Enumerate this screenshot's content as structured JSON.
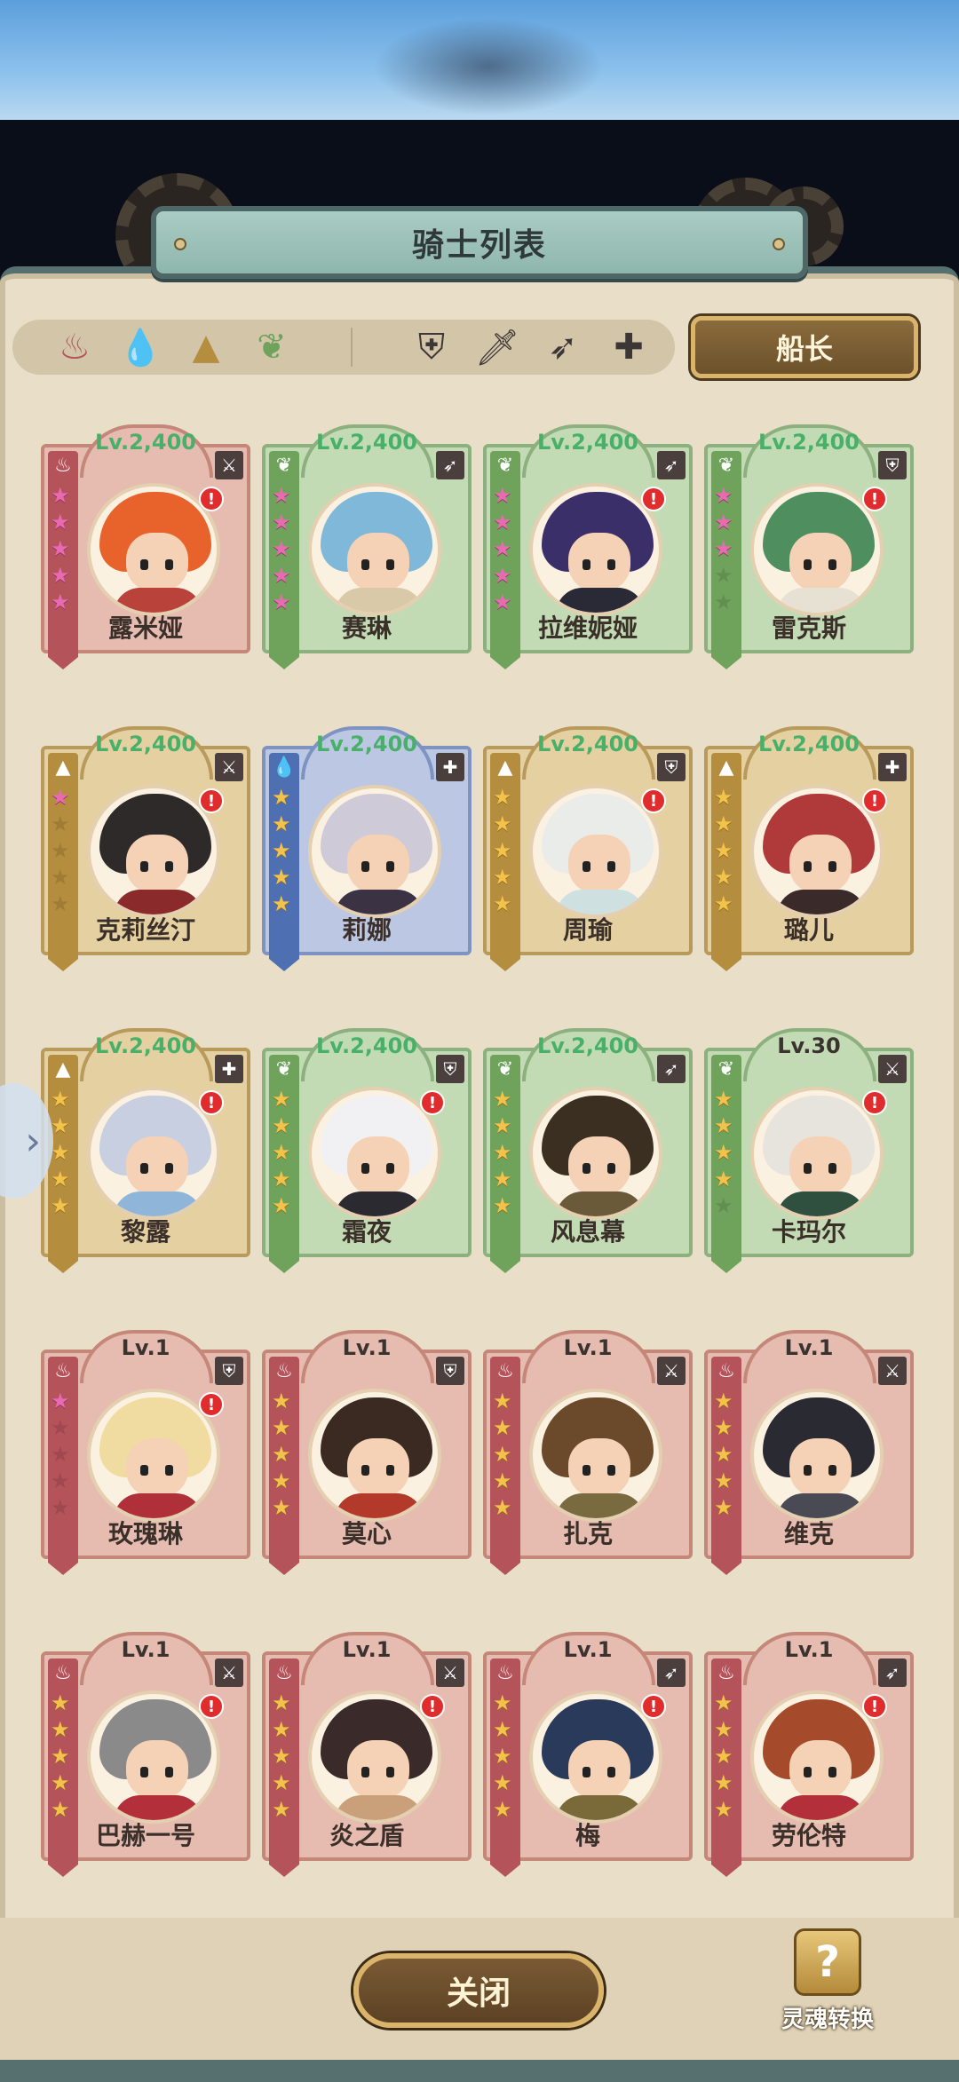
{
  "title": "骑士列表",
  "captain_label": "船长",
  "close_label": "关闭",
  "soul_convert_label": "灵魂转换",
  "soul_icon_glyph": "?",
  "side_arrow_glyph": "›",
  "filters": {
    "elements": [
      {
        "name": "fire-filter",
        "glyph": "♨",
        "color": "#b5535a"
      },
      {
        "name": "water-filter",
        "glyph": "💧",
        "color": "#4f6fb3"
      },
      {
        "name": "earth-filter",
        "glyph": "▲",
        "color": "#b58d3e"
      },
      {
        "name": "wind-filter",
        "glyph": "❦",
        "color": "#6fa35c"
      }
    ],
    "classes": [
      {
        "name": "shield-filter",
        "glyph": "⛨"
      },
      {
        "name": "sword-filter",
        "glyph": "🗡"
      },
      {
        "name": "bow-filter",
        "glyph": "➶"
      },
      {
        "name": "support-filter",
        "glyph": "✚"
      }
    ]
  },
  "knights": [
    {
      "name": "露米娅",
      "level": "Lv.2,400",
      "element": "fire",
      "stars": 5,
      "star_color": "pink",
      "class_glyph": "⚔",
      "alert": true,
      "hair": "#e8622c",
      "body": "#b9423a"
    },
    {
      "name": "赛琳",
      "level": "Lv.2,400",
      "element": "wind",
      "stars": 5,
      "star_color": "pink",
      "class_glyph": "➶",
      "alert": false,
      "hair": "#7fb8d8",
      "body": "#d9c9a8"
    },
    {
      "name": "拉维妮娅",
      "level": "Lv.2,400",
      "element": "wind",
      "stars": 5,
      "star_color": "pink",
      "class_glyph": "➶",
      "alert": true,
      "hair": "#3b2f6a",
      "body": "#2a2a36"
    },
    {
      "name": "雷克斯",
      "level": "Lv.2,400",
      "element": "wind",
      "stars": 3,
      "star_color": "pink",
      "class_glyph": "⛨",
      "alert": true,
      "hair": "#4f8f5f",
      "body": "#e7e1d4"
    },
    {
      "name": "克莉丝汀",
      "level": "Lv.2,400",
      "element": "earth",
      "stars": 1,
      "star_color": "pink",
      "class_glyph": "⚔",
      "alert": true,
      "hair": "#2e2a2a",
      "body": "#8a2a2a"
    },
    {
      "name": "莉娜",
      "level": "Lv.2,400",
      "element": "water",
      "stars": 5,
      "star_color": "gold",
      "class_glyph": "✚",
      "alert": false,
      "hair": "#cfcad8",
      "body": "#3b3344"
    },
    {
      "name": "周瑜",
      "level": "Lv.2,400",
      "element": "earth",
      "stars": 5,
      "star_color": "gold",
      "class_glyph": "⛨",
      "alert": true,
      "hair": "#e9ece8",
      "body": "#cfe0e0"
    },
    {
      "name": "璐儿",
      "level": "Lv.2,400",
      "element": "earth",
      "stars": 5,
      "star_color": "gold",
      "class_glyph": "✚",
      "alert": true,
      "hair": "#b03a3a",
      "body": "#3a2a2a"
    },
    {
      "name": "黎露",
      "level": "Lv.2,400",
      "element": "earth",
      "stars": 5,
      "star_color": "gold",
      "class_glyph": "✚",
      "alert": true,
      "hair": "#c7cfe0",
      "body": "#8fb6d8"
    },
    {
      "name": "霜夜",
      "level": "Lv.2,400",
      "element": "wind",
      "stars": 5,
      "star_color": "gold",
      "class_glyph": "⛨",
      "alert": true,
      "hair": "#f1f1f4",
      "body": "#2a2a30"
    },
    {
      "name": "风息幕",
      "level": "Lv.2,400",
      "element": "wind",
      "stars": 5,
      "star_color": "gold",
      "class_glyph": "➶",
      "alert": false,
      "hair": "#3a2f20",
      "body": "#6a5a3a"
    },
    {
      "name": "卡玛尔",
      "level": "Lv.30",
      "element": "wind",
      "stars": 4,
      "star_color": "gold",
      "class_glyph": "⚔",
      "alert": true,
      "hair": "#e6e4dc",
      "body": "#2f4f3f"
    },
    {
      "name": "玫瑰琳",
      "level": "Lv.1",
      "element": "fire",
      "stars": 1,
      "star_color": "pink",
      "class_glyph": "⛨",
      "alert": true,
      "hair": "#f0dca0",
      "body": "#b0303a"
    },
    {
      "name": "莫心",
      "level": "Lv.1",
      "element": "fire",
      "stars": 5,
      "star_color": "gold",
      "class_glyph": "⛨",
      "alert": false,
      "hair": "#3a2a22",
      "body": "#b33a2a"
    },
    {
      "name": "扎克",
      "level": "Lv.1",
      "element": "fire",
      "stars": 5,
      "star_color": "gold",
      "class_glyph": "⚔",
      "alert": false,
      "hair": "#6a4a2a",
      "body": "#7a6a40"
    },
    {
      "name": "维克",
      "level": "Lv.1",
      "element": "fire",
      "stars": 5,
      "star_color": "gold",
      "class_glyph": "⚔",
      "alert": false,
      "hair": "#2a2a32",
      "body": "#4a4a55"
    },
    {
      "name": "巴赫一号",
      "level": "Lv.1",
      "element": "fire",
      "stars": 5,
      "star_color": "gold",
      "class_glyph": "⚔",
      "alert": true,
      "hair": "#8a8a8a",
      "body": "#b3303a"
    },
    {
      "name": "炎之盾",
      "level": "Lv.1",
      "element": "fire",
      "stars": 5,
      "star_color": "gold",
      "class_glyph": "⚔",
      "alert": true,
      "hair": "#3a2a2a",
      "body": "#c9a07a"
    },
    {
      "name": "梅",
      "level": "Lv.1",
      "element": "fire",
      "stars": 5,
      "star_color": "gold",
      "class_glyph": "➶",
      "alert": true,
      "hair": "#2a3a5a",
      "body": "#7a6a3a"
    },
    {
      "name": "劳伦特",
      "level": "Lv.1",
      "element": "fire",
      "stars": 5,
      "star_color": "gold",
      "class_glyph": "➶",
      "alert": true,
      "hair": "#a54a2a",
      "body": "#b3303a"
    }
  ]
}
